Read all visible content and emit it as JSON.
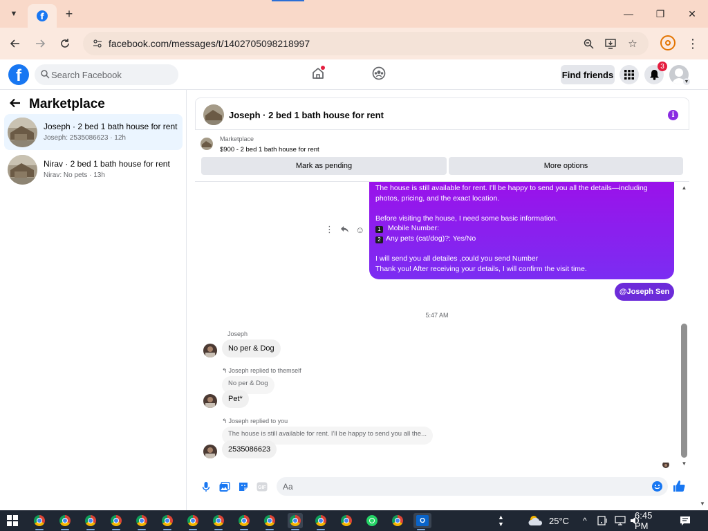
{
  "browser": {
    "tab_new_label": "+",
    "url": "facebook.com/messages/t/1402705098218997",
    "window_controls": {
      "minimize": "—",
      "maximize": "❐",
      "close": "✕"
    }
  },
  "fb": {
    "logo_letter": "f",
    "search_placeholder": "Search Facebook",
    "home_has_dot": true,
    "find_friends_label": "Find friends",
    "notifications_count": "3"
  },
  "sidebar": {
    "title": "Marketplace",
    "conversations": [
      {
        "title": "Joseph · 2 bed 1 bath house for rent",
        "subtitle": "Joseph: 2535086623 · 12h",
        "active": true
      },
      {
        "title": "Nirav · 2 bed 1 bath house for rent",
        "subtitle": "Nirav: No pets · 13h",
        "active": false
      }
    ]
  },
  "chat": {
    "header_title": "Joseph · 2 bed 1 bath house for rent",
    "listing": {
      "source": "Marketplace",
      "title": "$900 - 2 bed 1 bath house for rent",
      "mark_pending_label": "Mark as pending",
      "more_options_label": "More options"
    },
    "outgoing_message": {
      "line1": "The house is still available for rent. I'll be happy to send you all the details—including",
      "line2": "photos, pricing, and the exact location.",
      "line3": "Before visiting the house, I need some basic information.",
      "item1_num": "1",
      "item1": "Mobile Number:",
      "item2_num": "2",
      "item2": "Any pets (cat/dog)?: Yes/No",
      "line4": "I will send you all detailes ,could you send Number",
      "line5": "Thank you! After receiving your details, I will confirm the visit time."
    },
    "mention_chip": "@Joseph Sen",
    "timestamp": "5:47 AM",
    "sender_name": "Joseph",
    "incoming": [
      {
        "text": "No per & Dog"
      },
      {
        "reply_note": "Joseph replied to themself",
        "quote": "No per & Dog",
        "text": "Pet*"
      },
      {
        "reply_note": "Joseph replied to you",
        "quote": "The house is still available for rent. I'll be happy to send you all the...",
        "text": "2535086623"
      }
    ],
    "composer_placeholder": "Aa"
  },
  "taskbar": {
    "temperature": "25°C",
    "time": "6:45 PM"
  },
  "colors": {
    "fb_blue": "#1877f2",
    "messenger_purple": "#7b2df2",
    "notif_red": "#e41e3f",
    "chrome_tab_bg": "#f9d9c9"
  }
}
